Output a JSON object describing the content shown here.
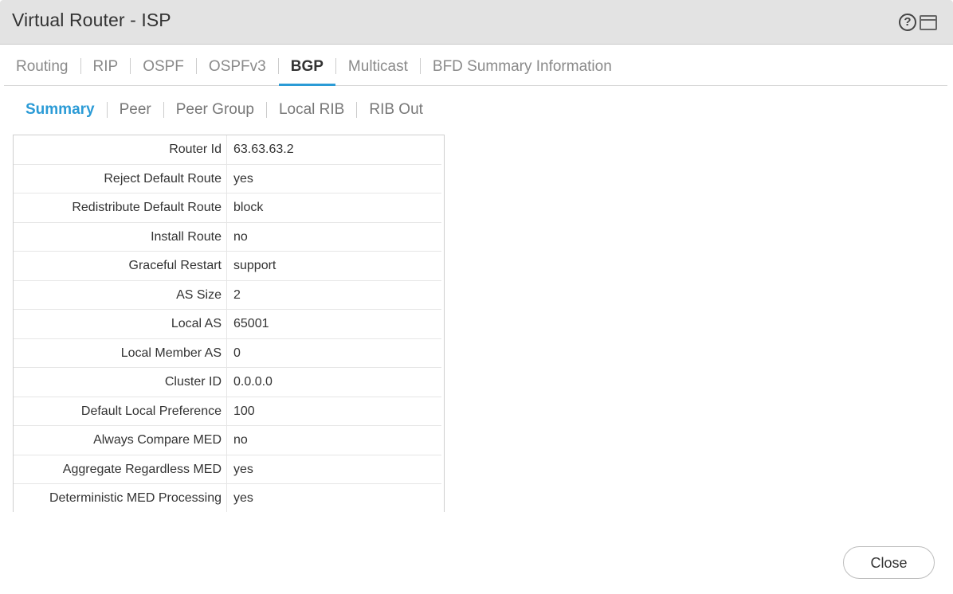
{
  "window": {
    "title": "Virtual Router - ISP",
    "icons": [
      "help-icon",
      "restore-window-icon"
    ],
    "help_glyph": "?"
  },
  "tabs": [
    {
      "label": "Routing",
      "active": false
    },
    {
      "label": "RIP",
      "active": false
    },
    {
      "label": "OSPF",
      "active": false
    },
    {
      "label": "OSPFv3",
      "active": false
    },
    {
      "label": "BGP",
      "active": true
    },
    {
      "label": "Multicast",
      "active": false
    },
    {
      "label": "BFD Summary Information",
      "active": false
    }
  ],
  "subtabs": [
    {
      "label": "Summary",
      "active": true
    },
    {
      "label": "Peer",
      "active": false
    },
    {
      "label": "Peer Group",
      "active": false
    },
    {
      "label": "Local RIB",
      "active": false
    },
    {
      "label": "RIB Out",
      "active": false
    }
  ],
  "summary": [
    {
      "key": "Router Id",
      "value": "63.63.63.2"
    },
    {
      "key": "Reject Default Route",
      "value": "yes"
    },
    {
      "key": "Redistribute Default Route",
      "value": "block"
    },
    {
      "key": "Install Route",
      "value": "no"
    },
    {
      "key": "Graceful Restart",
      "value": "support"
    },
    {
      "key": "AS Size",
      "value": "2"
    },
    {
      "key": "Local AS",
      "value": "65001"
    },
    {
      "key": "Local Member AS",
      "value": "0"
    },
    {
      "key": "Cluster ID",
      "value": "0.0.0.0"
    },
    {
      "key": "Default Local Preference",
      "value": "100"
    },
    {
      "key": "Always Compare MED",
      "value": "no"
    },
    {
      "key": "Aggregate Regardless MED",
      "value": "yes"
    },
    {
      "key": "Deterministic MED Processing",
      "value": "yes"
    }
  ],
  "footer": {
    "close_label": "Close"
  },
  "colors": {
    "accent": "#2b9bd6",
    "titlebar": "#e3e3e3"
  }
}
